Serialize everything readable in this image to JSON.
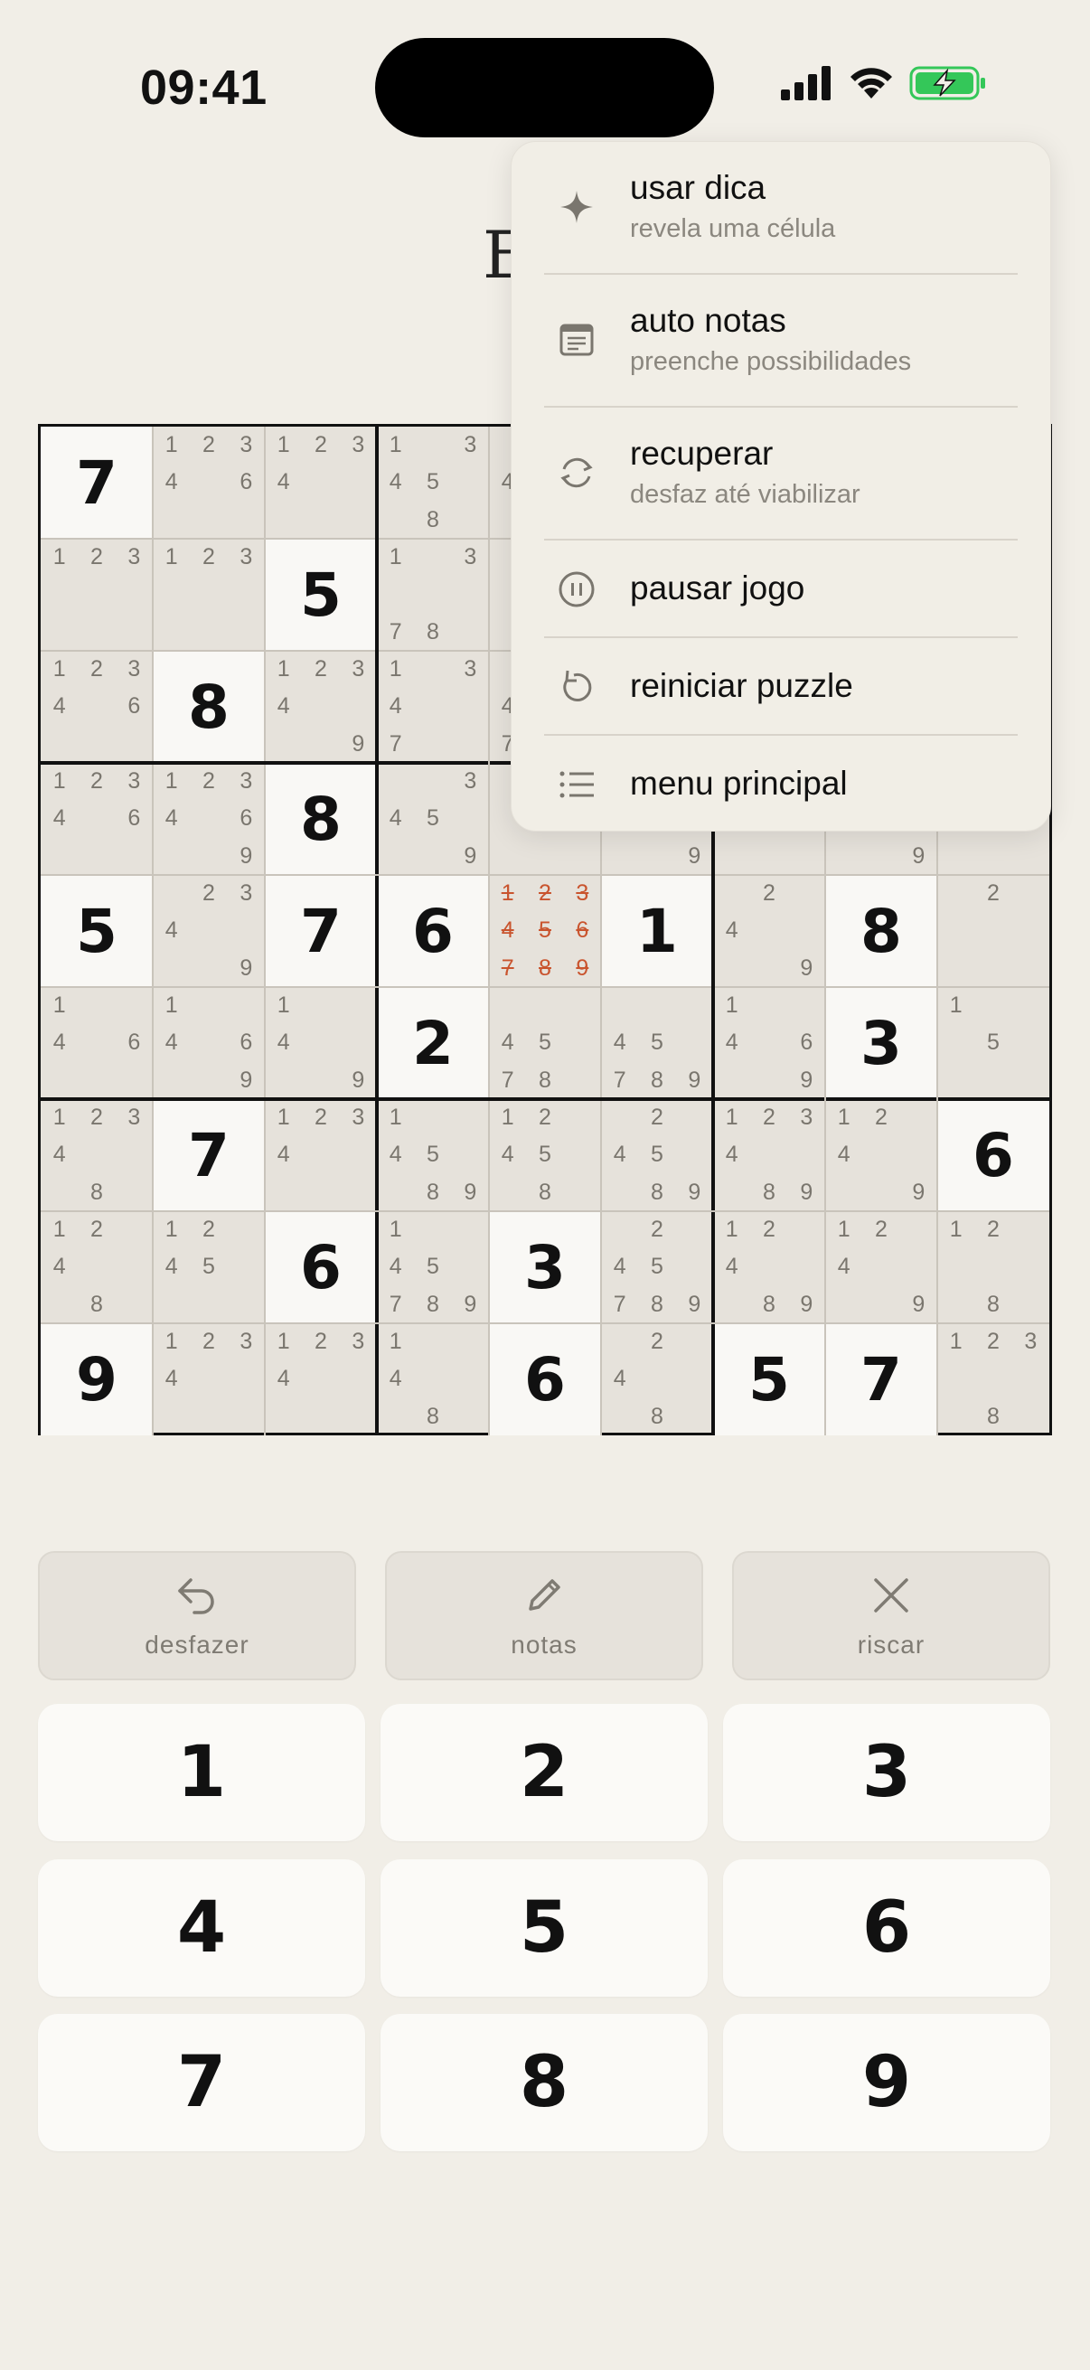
{
  "status_bar": {
    "time": "09:41",
    "icons": [
      "signal-icon",
      "wifi-icon",
      "battery-charging-icon"
    ]
  },
  "title_partial": "E",
  "board": {
    "givens": [
      [
        7,
        0,
        0,
        0,
        0,
        0,
        0,
        0,
        0
      ],
      [
        0,
        0,
        5,
        0,
        0,
        0,
        0,
        0,
        0
      ],
      [
        0,
        8,
        0,
        0,
        0,
        0,
        0,
        0,
        0
      ],
      [
        0,
        0,
        8,
        0,
        0,
        0,
        0,
        0,
        0
      ],
      [
        5,
        0,
        7,
        6,
        0,
        1,
        0,
        8,
        0
      ],
      [
        0,
        0,
        0,
        2,
        0,
        0,
        0,
        3,
        0
      ],
      [
        0,
        7,
        0,
        0,
        0,
        0,
        0,
        0,
        6
      ],
      [
        0,
        0,
        6,
        0,
        3,
        0,
        0,
        0,
        0
      ],
      [
        9,
        0,
        0,
        0,
        6,
        0,
        5,
        7,
        0
      ]
    ],
    "notes": [
      [
        [],
        [
          1,
          2,
          3,
          4,
          6
        ],
        [
          1,
          2,
          3,
          4
        ],
        [
          1,
          3,
          4,
          5,
          8
        ],
        [
          4
        ],
        [],
        [],
        [],
        []
      ],
      [
        [
          1,
          2,
          3
        ],
        [
          1,
          2,
          3
        ],
        [],
        [
          1,
          3,
          7,
          8
        ],
        [],
        [],
        [],
        [],
        []
      ],
      [
        [
          1,
          2,
          3,
          4,
          6
        ],
        [],
        [
          1,
          2,
          3,
          4,
          9
        ],
        [
          1,
          3,
          4,
          7
        ],
        [
          4,
          7
        ],
        [],
        [],
        [],
        []
      ],
      [
        [
          1,
          2,
          3,
          4,
          6
        ],
        [
          1,
          2,
          3,
          4,
          6,
          9
        ],
        [],
        [
          3,
          4,
          5,
          9
        ],
        [],
        [
          9
        ],
        [],
        [
          9
        ],
        []
      ],
      [
        [],
        [
          2,
          3,
          4,
          9
        ],
        [],
        [],
        [
          1,
          2,
          3,
          4,
          5,
          6,
          7,
          8,
          9
        ],
        [],
        [
          2,
          4,
          9
        ],
        [],
        [
          2
        ]
      ],
      [
        [
          1,
          4,
          6
        ],
        [
          1,
          4,
          6,
          9
        ],
        [
          1,
          4,
          9
        ],
        [],
        [
          4,
          5,
          7,
          8
        ],
        [
          4,
          5,
          7,
          8,
          9
        ],
        [
          1,
          4,
          6,
          9
        ],
        [],
        [
          1,
          5
        ]
      ],
      [
        [
          1,
          2,
          3,
          4,
          8
        ],
        [],
        [
          1,
          2,
          3,
          4
        ],
        [
          1,
          4,
          5,
          8,
          9
        ],
        [
          1,
          2,
          4,
          5,
          8
        ],
        [
          2,
          4,
          5,
          8,
          9
        ],
        [
          1,
          2,
          3,
          4,
          8,
          9
        ],
        [
          1,
          2,
          4,
          9
        ],
        []
      ],
      [
        [
          1,
          2,
          4,
          8
        ],
        [
          1,
          2,
          4,
          5
        ],
        [],
        [
          1,
          4,
          5,
          7,
          8,
          9
        ],
        [],
        [
          2,
          4,
          5,
          7,
          8,
          9
        ],
        [
          1,
          2,
          4,
          8,
          9
        ],
        [
          1,
          2,
          4,
          9
        ],
        [
          1,
          2,
          8
        ]
      ],
      [
        [],
        [
          1,
          2,
          3,
          4
        ],
        [
          1,
          2,
          3,
          4
        ],
        [
          1,
          4,
          8
        ],
        [],
        [
          2,
          4,
          8
        ],
        [],
        [],
        [
          1,
          2,
          3,
          8
        ]
      ]
    ],
    "struck_cell": [
      4,
      4
    ]
  },
  "menu": {
    "items": [
      {
        "icon": "sparkle-icon",
        "title": "usar dica",
        "subtitle": "revela uma célula"
      },
      {
        "icon": "notepad-icon",
        "title": "auto notas",
        "subtitle": "preenche possibilidades"
      },
      {
        "icon": "recover-cycle-icon",
        "title": "recuperar",
        "subtitle": "desfaz até viabilizar"
      },
      {
        "icon": "pause-icon",
        "title": "pausar jogo",
        "subtitle": ""
      },
      {
        "icon": "restart-icon",
        "title": "reiniciar puzzle",
        "subtitle": ""
      },
      {
        "icon": "list-icon",
        "title": "menu principal",
        "subtitle": ""
      }
    ]
  },
  "tools": [
    {
      "icon": "undo-icon",
      "label": "desfazer"
    },
    {
      "icon": "pencil-icon",
      "label": "notas"
    },
    {
      "icon": "close-icon",
      "label": "riscar"
    }
  ],
  "keypad": [
    "1",
    "2",
    "3",
    "4",
    "5",
    "6",
    "7",
    "8",
    "9"
  ],
  "colors": {
    "background": "#f1eee7",
    "note_strike": "#c9542e",
    "battery_fill": "#34c759"
  }
}
